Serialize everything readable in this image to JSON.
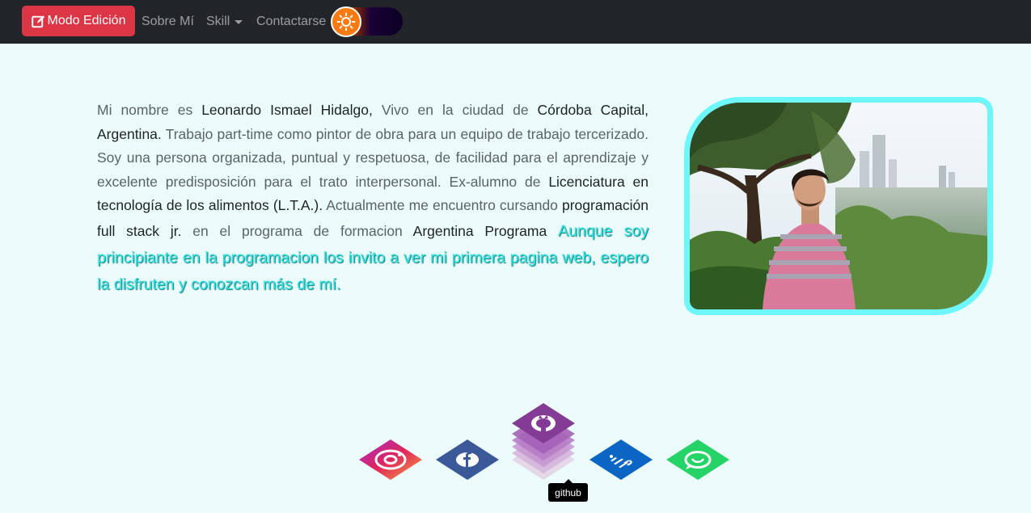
{
  "navbar": {
    "edit_button": "Modo Edición",
    "links": [
      "Sobre Mí",
      "Skill",
      "Contactarse"
    ]
  },
  "about": {
    "p1": "Mi nombre es ",
    "name": "Leonardo Ismael Hidalgo,",
    "p2": " Vivo en la ciudad de ",
    "city": "Córdoba Capital, Argentina.",
    "p3": " Trabajo part-time como pintor de obra para un equipo de trabajo tercerizado. Soy una persona organizada, puntual y respetuosa, de facilidad para el aprendizaje y excelente predisposición para el trato interpersonal. Ex-alumno de ",
    "degree": "Licenciatura en tecnología de los alimentos (L.T.A.).",
    "p4": " Actualmente me encuentro cursando ",
    "course": "programación full stack jr.",
    "p5": " en el programa de formacion ",
    "program": "Argentina Programa",
    "highlight": "Aunque soy principiante en la programacion los invito a ver mi primera pagina web, espero la disfruten y conozcan más de mí."
  },
  "social": {
    "icons": [
      "instagram-icon",
      "facebook-icon",
      "github-icon",
      "linkedin-icon",
      "whatsapp-icon"
    ],
    "colors": [
      "#d62e6e",
      "#3b5998",
      "#7e3f8f",
      "#0a66c2",
      "#25d366"
    ],
    "tooltip": "github"
  },
  "colors": {
    "accent": "#6df7fb",
    "edit_button": "#dc3545",
    "navbar": "#212529",
    "background": "#ecfcfd"
  }
}
